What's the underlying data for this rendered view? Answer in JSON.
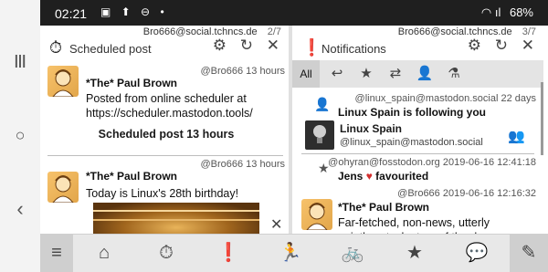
{
  "android_nav": {
    "recent_icon": "recents-icon",
    "home_icon": "home-circle-icon",
    "back_icon": "back-chevron-icon",
    "recent_glyph": "|||",
    "home_glyph": "○",
    "back_glyph": "‹"
  },
  "statusbar": {
    "time": "02:21",
    "left_icons": "▣ ⬆ ⊖ •",
    "battery": "68%",
    "signal": "◠ ıl"
  },
  "left_column": {
    "account": "Bro666@social.tchncs.de",
    "position": "2/7",
    "title": "Scheduled post",
    "title_icon": "⏱",
    "tools": [
      "⚙",
      "↻",
      "✕"
    ],
    "posts": [
      {
        "display_name": "*The* Paul Brown",
        "meta": "@Bro666  13 hours",
        "content": "Posted from online scheduler at https://scheduler.mastodon.tools/",
        "note": "Scheduled post 13 hours"
      },
      {
        "display_name": "*The* Paul Brown",
        "meta": "@Bro666  13 hours",
        "content": "Today is Linux's 28th birthday!"
      }
    ],
    "media_close": "✕"
  },
  "right_column": {
    "account": "Bro666@social.tchncs.de",
    "position": "3/7",
    "title": "Notifications",
    "title_icon": "❗",
    "tools": [
      "⚙",
      "↻",
      "✕"
    ],
    "tabs": [
      {
        "label": "All",
        "icon": "all-tab"
      },
      {
        "label": "↩",
        "icon": "reply-icon"
      },
      {
        "label": "★",
        "icon": "star-icon"
      },
      {
        "label": "⇄",
        "icon": "boost-icon"
      },
      {
        "label": "👤",
        "icon": "follow-icon"
      },
      {
        "label": "⚗",
        "icon": "poll-icon"
      }
    ],
    "notifications": [
      {
        "meta": "@linux_spain@mastodon.social  22 days",
        "text": "Linux Spain is following you",
        "card_name": "Linux Spain",
        "card_account": "@linux_spain@mastodon.social"
      },
      {
        "meta": "@ohyran@fosstodon.org  2019-06-16 12:41:18",
        "text_prefix": "Jens",
        "heart": "♥",
        "text_suffix": "favourited"
      },
      {
        "meta": "@Bro666  2019-06-16 12:16:32",
        "display_name": "*The* Paul Brown",
        "content": "Far-fetched, non-news, utterly pointless tech story of the day:"
      }
    ]
  },
  "bottom_nav": {
    "items": [
      "≡",
      "⌂",
      "⏱",
      "❗",
      "🏃",
      "🚲",
      "★",
      "💬",
      "✎"
    ]
  }
}
